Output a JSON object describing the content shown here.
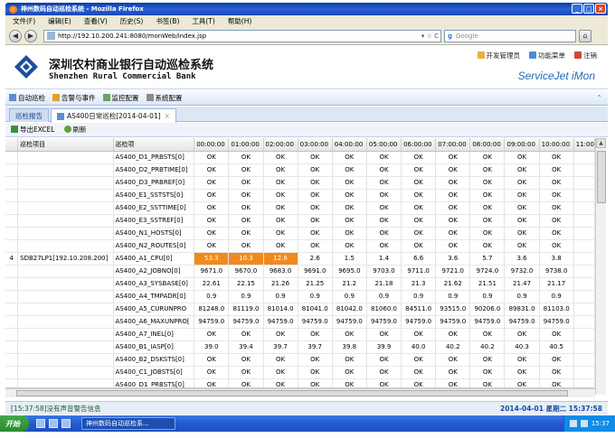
{
  "browser": {
    "title": "神州数码自动巡检系统 - Mozilla Firefox",
    "menu": [
      "文件(F)",
      "编辑(E)",
      "查看(V)",
      "历史(S)",
      "书签(B)",
      "工具(T)",
      "帮助(H)"
    ],
    "url": "http://192.10.200.241:8080/monWeb/index.jsp",
    "search_placeholder": "Google"
  },
  "header": {
    "name_cn": "深圳农村商业银行自动巡检系统",
    "name_en": "Shenzhen Rural Commercial Bank",
    "product": "ServiceJet iMon",
    "links": [
      "开发管理员",
      "功能菜单",
      "注销"
    ],
    "colors": {
      "accent": "#1e6ab4"
    }
  },
  "modules": [
    "自动巡检",
    "告警与事件",
    "监控配置",
    "系统配置"
  ],
  "tabs": [
    {
      "label": "巡检报告"
    },
    {
      "label": "AS400日常巡检[2014-04-01]"
    }
  ],
  "toolbar": {
    "export_label": "导出EXCEL",
    "refresh_label": "刷新"
  },
  "grid": {
    "columns": [
      "巡检项目",
      "巡检项",
      "00:00:00",
      "01:00:00",
      "02:00:00",
      "03:00:00",
      "04:00:00",
      "05:00:00",
      "06:00:00",
      "07:00:00",
      "08:00:00",
      "09:00:00",
      "10:00:00",
      "11:00"
    ],
    "group_row": {
      "index": "4",
      "item": "SDB27LP1[192.10.208.200]"
    },
    "rows": [
      {
        "name": "AS400_D1_PRBSTS[0]",
        "values": [
          "OK",
          "OK",
          "OK",
          "OK",
          "OK",
          "OK",
          "OK",
          "OK",
          "OK",
          "OK",
          "OK"
        ]
      },
      {
        "name": "AS400_D2_PRBTIME[0]",
        "values": [
          "OK",
          "OK",
          "OK",
          "OK",
          "OK",
          "OK",
          "OK",
          "OK",
          "OK",
          "OK",
          "OK"
        ]
      },
      {
        "name": "AS400_D3_PRBREF[0]",
        "values": [
          "OK",
          "OK",
          "OK",
          "OK",
          "OK",
          "OK",
          "OK",
          "OK",
          "OK",
          "OK",
          "OK"
        ]
      },
      {
        "name": "AS400_E1_SSTSTS[0]",
        "values": [
          "OK",
          "OK",
          "OK",
          "OK",
          "OK",
          "OK",
          "OK",
          "OK",
          "OK",
          "OK",
          "OK"
        ]
      },
      {
        "name": "AS400_E2_SSTTIME[0]",
        "values": [
          "OK",
          "OK",
          "OK",
          "OK",
          "OK",
          "OK",
          "OK",
          "OK",
          "OK",
          "OK",
          "OK"
        ]
      },
      {
        "name": "AS400_E3_SSTREF[0]",
        "values": [
          "OK",
          "OK",
          "OK",
          "OK",
          "OK",
          "OK",
          "OK",
          "OK",
          "OK",
          "OK",
          "OK"
        ]
      },
      {
        "name": "AS400_N1_HOSTS[0]",
        "values": [
          "OK",
          "OK",
          "OK",
          "OK",
          "OK",
          "OK",
          "OK",
          "OK",
          "OK",
          "OK",
          "OK"
        ]
      },
      {
        "name": "AS400_N2_ROUTES[0]",
        "values": [
          "OK",
          "OK",
          "OK",
          "OK",
          "OK",
          "OK",
          "OK",
          "OK",
          "OK",
          "OK",
          "OK"
        ]
      },
      {
        "name": "AS400_A1_CPU[0]",
        "group": true,
        "alerts": [
          0,
          1,
          2
        ],
        "values": [
          "53.3",
          "10.3",
          "12.6",
          "2.6",
          "1.5",
          "1.4",
          "6.6",
          "3.6",
          "5.7",
          "3.6",
          "3.8"
        ]
      },
      {
        "name": "AS400_A2_JOBNO[0]",
        "values": [
          "9671.0",
          "9670.0",
          "9683.0",
          "9691.0",
          "9695.0",
          "9703.0",
          "9711.0",
          "9721.0",
          "9724.0",
          "9732.0",
          "9738.0"
        ]
      },
      {
        "name": "AS400_A3_SYSBASE[0]",
        "values": [
          "22.61",
          "22.15",
          "21.26",
          "21.25",
          "21.2",
          "21.18",
          "21.3",
          "21.62",
          "21.51",
          "21.47",
          "21.17"
        ]
      },
      {
        "name": "AS400_A4_TMPADR[0]",
        "values": [
          "0.9",
          "0.9",
          "0.9",
          "0.9",
          "0.9",
          "0.9",
          "0.9",
          "0.9",
          "0.9",
          "0.9",
          "0.9"
        ]
      },
      {
        "name": "AS400_A5_CURUNPRO",
        "values": [
          "81248.0",
          "81119.0",
          "81014.0",
          "81041.0",
          "81042.0",
          "81060.0",
          "84511.0",
          "93515.0",
          "90206.0",
          "89831.0",
          "81103.0"
        ]
      },
      {
        "name": "AS400_A6_MAXUNPRO[",
        "values": [
          "94759.0",
          "94759.0",
          "94759.0",
          "94759.0",
          "94759.0",
          "94759.0",
          "94759.0",
          "94759.0",
          "94759.0",
          "94759.0",
          "94759.0"
        ]
      },
      {
        "name": "AS400_A7_INEL[0]",
        "values": [
          "OK",
          "OK",
          "OK",
          "OK",
          "OK",
          "OK",
          "OK",
          "OK",
          "OK",
          "OK",
          "OK"
        ]
      },
      {
        "name": "AS400_B1_IASP[0]",
        "values": [
          "39.0",
          "39.4",
          "39.7",
          "39.7",
          "39.8",
          "39.9",
          "40.0",
          "40.2",
          "40.2",
          "40.3",
          "40.5"
        ]
      },
      {
        "name": "AS400_B2_DSKSTS[0]",
        "values": [
          "OK",
          "OK",
          "OK",
          "OK",
          "OK",
          "OK",
          "OK",
          "OK",
          "OK",
          "OK",
          "OK"
        ]
      },
      {
        "name": "AS400_C1_JOBSTS[0]",
        "values": [
          "OK",
          "OK",
          "OK",
          "OK",
          "OK",
          "OK",
          "OK",
          "OK",
          "OK",
          "OK",
          "OK"
        ]
      },
      {
        "name": "AS400_D1_PRBSTS[0]",
        "values": [
          "OK",
          "OK",
          "OK",
          "OK",
          "OK",
          "OK",
          "OK",
          "OK",
          "OK",
          "OK",
          "OK"
        ]
      }
    ]
  },
  "status": {
    "message": "[15:37:58]没有声音警告信息",
    "datetime": "2014-04-01 星期二 15:37:58"
  },
  "taskbar": {
    "start": "开始",
    "task": "神州数码自动巡检系...",
    "clock": "15:37"
  }
}
